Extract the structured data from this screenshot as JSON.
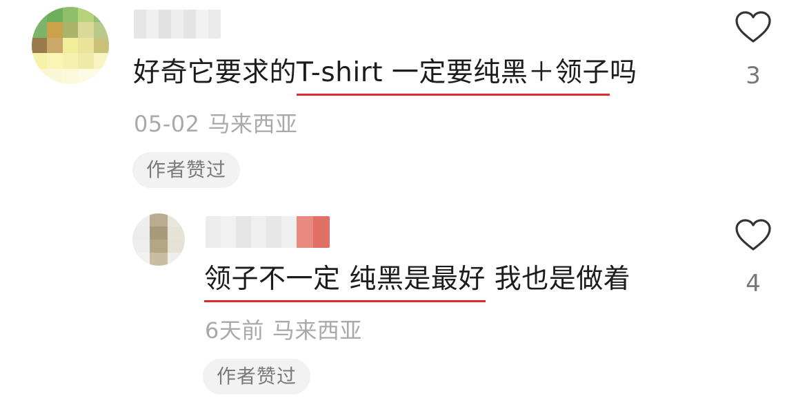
{
  "comments": [
    {
      "text_segments": [
        {
          "text": "好奇它要求的",
          "underline": false
        },
        {
          "text": "T-shirt 一定要纯黑＋领子",
          "underline": true
        },
        {
          "text": "吗",
          "underline": false
        }
      ],
      "date": "05-02",
      "location": "马来西亚",
      "badge": "作者赞过",
      "likes": "3",
      "avatar_colors": [
        "#7ab66a",
        "#6fae5a",
        "#8fbf6a",
        "#b6d27a",
        "#94c07a",
        "#7db46a",
        "#c9a24a",
        "#a9b46a",
        "#d9d99a",
        "#b9c98a",
        "#9a7a4a",
        "#c9a86a",
        "#f1ee9a",
        "#e9e49a",
        "#c9c07a",
        "#f6f3a8",
        "#f9f6b5",
        "#f3f0b0",
        "#eeeaa8",
        "#f7f4c0",
        "#f8f6cf",
        "#f9f7d6",
        "#fbf9da",
        "#fcfae2",
        "#fdfbe8"
      ]
    },
    {
      "text_segments": [
        {
          "text": "领子不一定 纯黑是最好",
          "underline": true
        },
        {
          "text": " 我也是做着",
          "underline": false
        }
      ],
      "date": "6天前",
      "location": "马来西亚",
      "badge": "作者赞过",
      "likes": "4",
      "avatar_colors": [
        "#eeeeee",
        "#b8ad90",
        "#e9e6dc",
        "#ececec",
        "#a89a7a",
        "#e6e2d6",
        "#eeeeee",
        "#b3a684",
        "#e5e1d4",
        "#f2f2f2",
        "#c8bea4",
        "#efeee8"
      ]
    }
  ]
}
